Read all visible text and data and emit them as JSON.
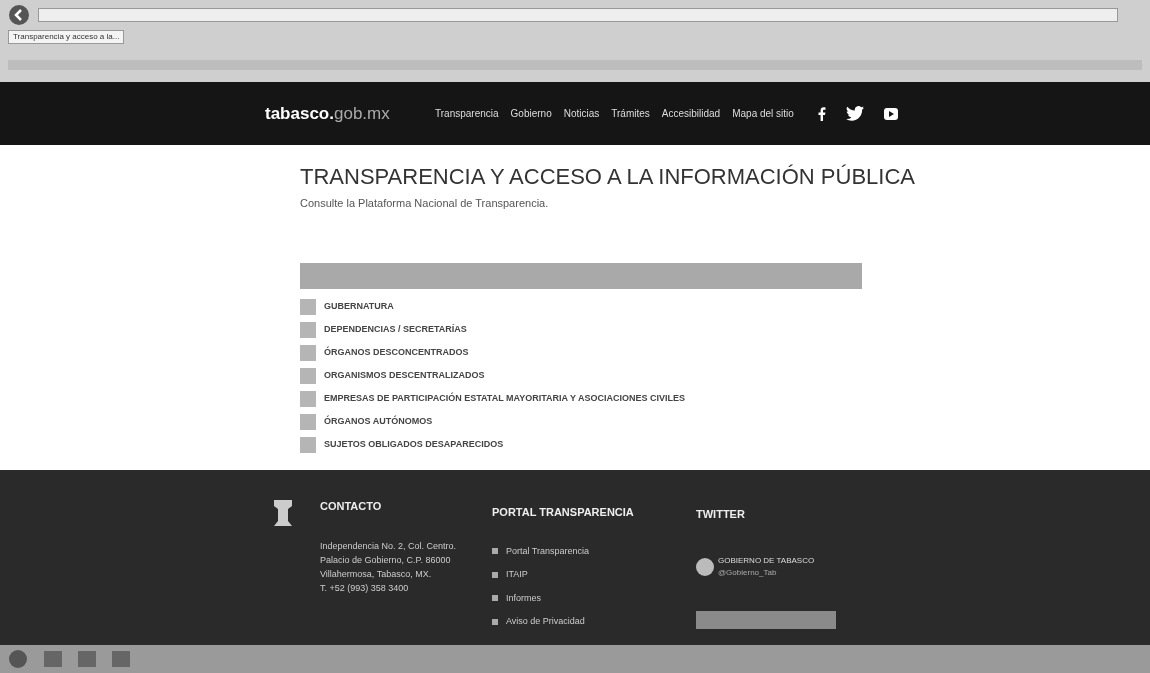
{
  "browser": {
    "tab_title": "Transparencia y acceso a la..."
  },
  "header": {
    "logo_main": "tabasco.",
    "logo_suffix": "gob.mx",
    "nav": [
      "Transparencia",
      "Gobierno",
      "Noticias",
      "Trámites",
      "Accesibilidad",
      "Mapa del sitio"
    ]
  },
  "page": {
    "title": "TRANSPARENCIA Y ACCESO A LA INFORMACIÓN PÚBLICA",
    "subtitle": "Consulte la Plataforma Nacional de Transparencia.",
    "items": [
      "GUBERNATURA",
      "DEPENDENCIAS / SECRETARÍAS",
      "ÓRGANOS DESCONCENTRADOS",
      "ORGANISMOS DESCENTRALIZADOS",
      "EMPRESAS DE PARTICIPACIÓN ESTATAL MAYORITARIA Y ASOCIACIONES CIVILES",
      "ÓRGANOS AUTÓNOMOS",
      "SUJETOS OBLIGADOS DESAPARECIDOS"
    ]
  },
  "footer": {
    "contact_heading": "CONTACTO",
    "contact_lines": [
      "Independencia No. 2, Col. Centro.",
      "Palacio de Gobierno, C.P. 86000",
      "Villahermosa, Tabasco, MX.",
      "T. +52 (993) 358 3400"
    ],
    "portal_heading": "PORTAL TRANSPARENCIA",
    "portal_links": [
      "Portal Transparencia",
      "ITAIP",
      "Informes",
      "Aviso de Privacidad"
    ],
    "twitter_heading": "TWITTER",
    "tweet_author": "GOBIERNO DE TABASCO",
    "tweet_handle": "@Gobierno_Tab"
  }
}
